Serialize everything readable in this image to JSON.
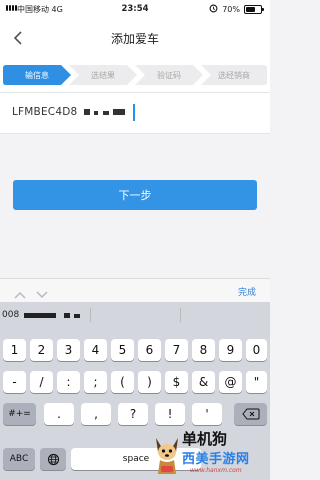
{
  "status_bar": {
    "carrier": "中国移动",
    "network": "4G",
    "time": "23:54",
    "battery": "70%",
    "battery_level": 0.7
  },
  "nav": {
    "title": "添加爱车"
  },
  "steps": [
    {
      "label": "输信息",
      "active": true
    },
    {
      "label": "选结果",
      "active": false
    },
    {
      "label": "验证码",
      "active": false
    },
    {
      "label": "选经销商",
      "active": false
    }
  ],
  "vin_input": {
    "value": "LFMBEC4D8"
  },
  "next_button": {
    "label": "下一步"
  },
  "accessory": {
    "done_label": "完成"
  },
  "suggestion": {
    "text": "008"
  },
  "keyboard": {
    "row1": [
      "1",
      "2",
      "3",
      "4",
      "5",
      "6",
      "7",
      "8",
      "9",
      "0"
    ],
    "row2": [
      "-",
      "/",
      ":",
      ";",
      "(",
      ")",
      "$",
      "&",
      "@",
      "\""
    ],
    "row3_mode": "#+=",
    "row3": [
      ".",
      ",",
      "?",
      "!",
      "'"
    ],
    "row4_mode": "ABC",
    "space_label": "space"
  },
  "watermark": {
    "name": "单机狗",
    "site": "西美手游网",
    "url": "www.hanxm.com"
  },
  "colors": {
    "accent": "#3393e5",
    "step_active": "#2f8fe3",
    "link": "#2f7fd6"
  }
}
